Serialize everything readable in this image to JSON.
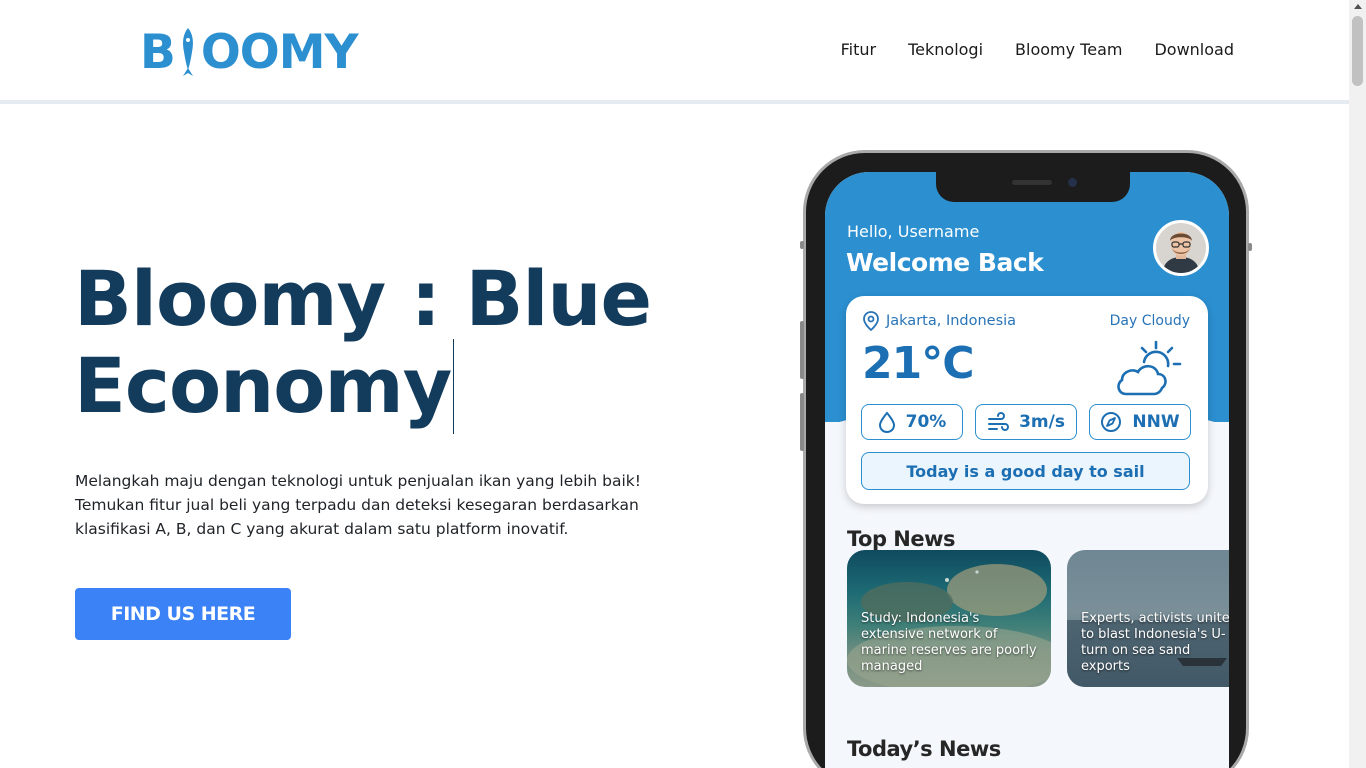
{
  "brand": {
    "name": "BLOOMY",
    "part1": "B",
    "part2": "OOMY",
    "color": "#2b8fd0"
  },
  "nav": {
    "items": [
      "Fitur",
      "Teknologi",
      "Bloomy Team",
      "Download"
    ]
  },
  "hero": {
    "title": "Bloomy : Blue Economy",
    "description": "Melangkah maju dengan teknologi untuk penjualan ikan yang lebih baik! Temukan fitur jual beli yang terpadu dan deteksi kesegaran berdasarkan klasifikasi A, B, dan C yang akurat dalam satu platform inovatif.",
    "cta_label": "FIND US HERE",
    "title_color": "#133b5c",
    "cta_color": "#3b82f6"
  },
  "app": {
    "greeting": "Hello, Username",
    "welcome": "Welcome Back",
    "weather": {
      "location": "Jakarta, Indonesia",
      "condition": "Day Cloudy",
      "temperature": "21°C",
      "humidity": "70%",
      "wind_speed": "3m/s",
      "wind_direction": "NNW",
      "advice": "Today is a good day to sail"
    },
    "top_news_title": "Top News",
    "news": [
      {
        "caption": "Study: Indonesia's extensive network of marine reserves are poorly managed"
      },
      {
        "caption": "Experts, activists unite to blast Indonesia's U-turn on sea sand exports"
      }
    ],
    "todays_news_title": "Today’s News",
    "accent": "#2b8fd0"
  }
}
